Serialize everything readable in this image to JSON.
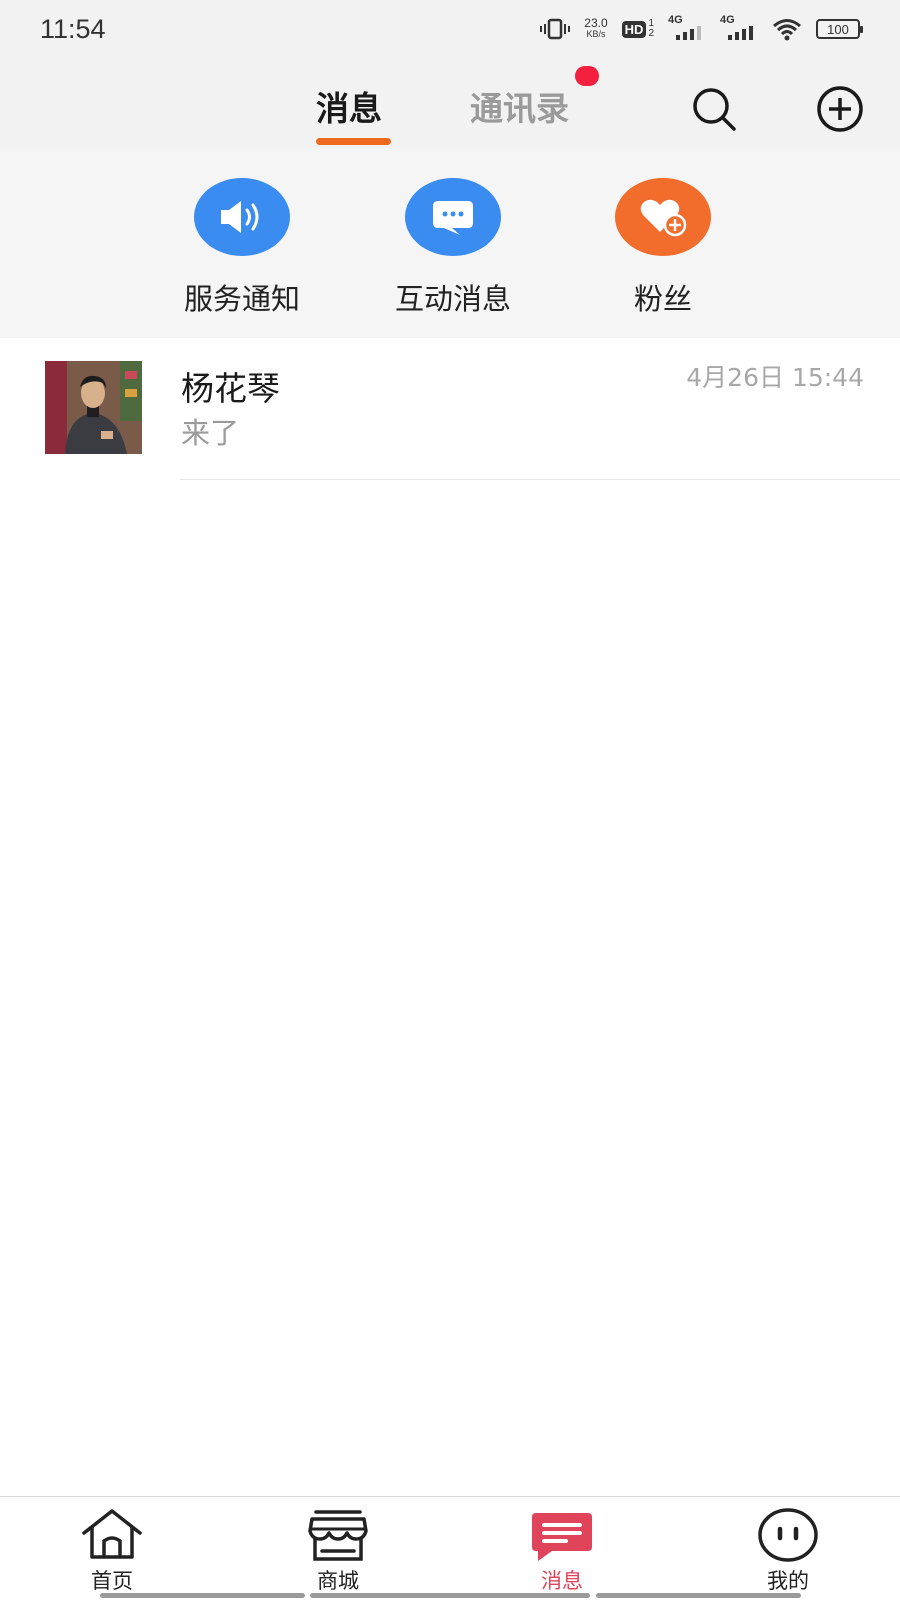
{
  "status_bar": {
    "time": "11:54",
    "net_speed_value": "23.0",
    "net_speed_unit": "KB/s",
    "hd_label": "HD",
    "hd_sub_top": "1",
    "hd_sub_bottom": "2",
    "sim1_label": "4G",
    "sim2_label": "4G",
    "battery": "100"
  },
  "header": {
    "tabs": [
      {
        "label": "消息",
        "active": true
      },
      {
        "label": "通讯录",
        "active": false,
        "has_badge": true
      }
    ],
    "accent_color": "#ee6a1f",
    "badge_color": "#f5203d"
  },
  "shortcuts": [
    {
      "label": "服务通知",
      "icon": "speaker-icon",
      "color": "#3a8cf0"
    },
    {
      "label": "互动消息",
      "icon": "chat-bubble-icon",
      "color": "#3a8cf0"
    },
    {
      "label": "粉丝",
      "icon": "heart-plus-icon",
      "color": "#f26c2c"
    }
  ],
  "conversations": [
    {
      "name": "杨花琴",
      "preview": "来了",
      "time": "4月26日 15:44",
      "avatar": "user-photo"
    }
  ],
  "bottom_nav": [
    {
      "label": "首页",
      "icon": "home-icon",
      "active": false
    },
    {
      "label": "商城",
      "icon": "store-icon",
      "active": false
    },
    {
      "label": "消息",
      "icon": "message-icon",
      "active": true
    },
    {
      "label": "我的",
      "icon": "face-icon",
      "active": false
    }
  ],
  "active_nav_color": "#e0445a"
}
